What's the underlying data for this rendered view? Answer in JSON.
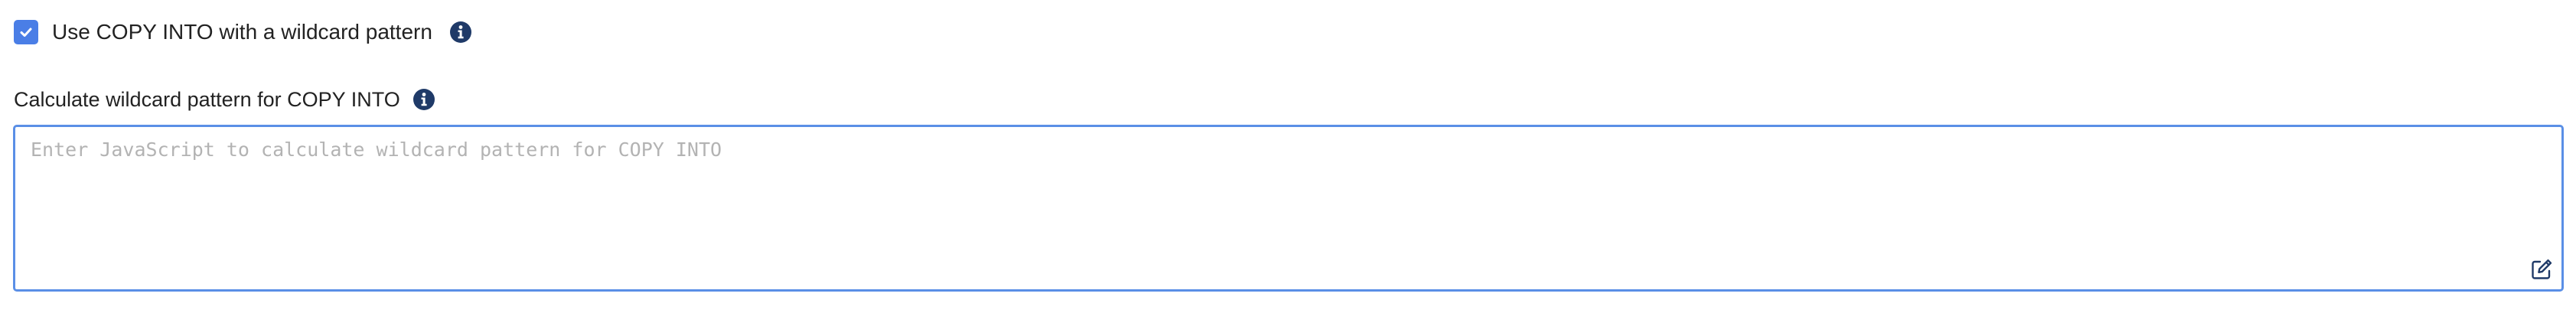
{
  "wildcard_option": {
    "checkbox_checked": true,
    "label": "Use COPY INTO with a wildcard pattern",
    "info_icon": "info-circle-icon"
  },
  "wildcard_script_field": {
    "label": "Calculate wildcard pattern for COPY INTO",
    "info_icon": "info-circle-icon",
    "value": "",
    "placeholder": "Enter JavaScript to calculate wildcard pattern for COPY INTO",
    "expand_editor_icon": "edit-pencil-square-icon"
  },
  "colors": {
    "accent": "#4a7ee6",
    "focus_border": "#5a8fe6",
    "info_icon": "#1f3a68",
    "placeholder": "#b3b3b3",
    "text": "#222222"
  }
}
